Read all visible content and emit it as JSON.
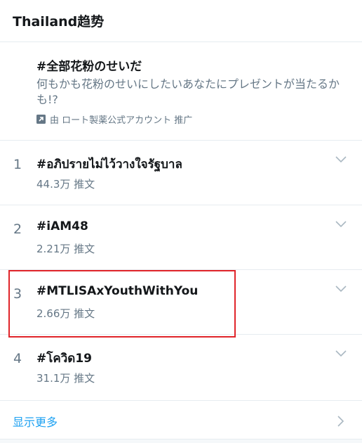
{
  "header": {
    "title": "Thailand趋势"
  },
  "promo": {
    "title": "#全部花粉のせいだ",
    "description": "何もかも花粉のせいにしたいあなたにプレゼントが当たるかも!?",
    "footer": "由 ロート製薬公式アカウント 推广",
    "icon": "promoted-arrow-icon"
  },
  "trends": [
    {
      "rank": "1",
      "name": "#อภิปรายไม่ไว้วางใจรัฐบาล",
      "count": "44.3万 推文"
    },
    {
      "rank": "2",
      "name": "#iAM48",
      "count": "2.21万 推文"
    },
    {
      "rank": "3",
      "name": "#MTLISAxYouthWithYou",
      "count": "2.66万 推文",
      "highlighted": true
    },
    {
      "rank": "4",
      "name": "#โควิด19",
      "count": "31.1万 推文"
    }
  ],
  "show_more": {
    "label": "显示更多"
  },
  "colors": {
    "accent": "#1da1f2",
    "text_primary": "#14171a",
    "text_secondary": "#657786",
    "highlight_box": "#e0242a",
    "divider": "#e6ecf0"
  }
}
